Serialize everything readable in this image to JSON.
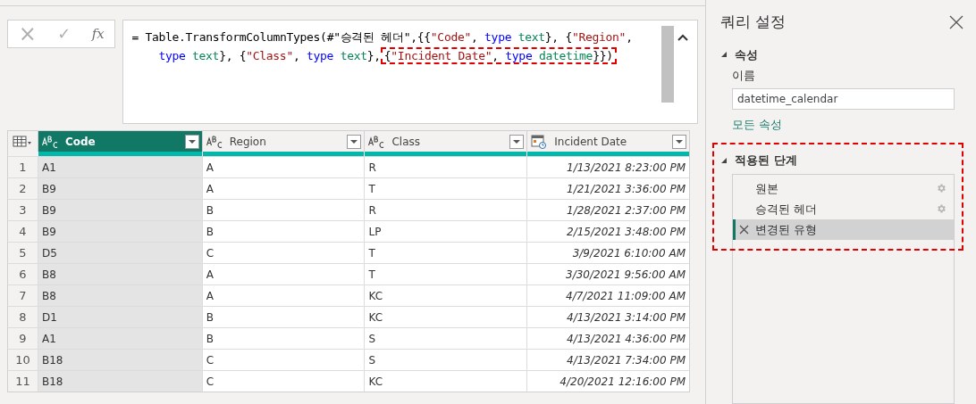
{
  "formula_bar": {
    "cancel": "×",
    "confirm": "✓",
    "fx": "fx",
    "lines": [
      {
        "tokens": [
          {
            "kind": "plain",
            "text": "= Table.TransformColumnTypes(#\"승격된 헤더\",{{"
          },
          {
            "kind": "string",
            "text": "\"Code\""
          },
          {
            "kind": "plain",
            "text": ", "
          },
          {
            "kind": "keyword",
            "text": "type "
          },
          {
            "kind": "type",
            "text": "text"
          },
          {
            "kind": "plain",
            "text": "}, {"
          },
          {
            "kind": "string",
            "text": "\"Region\""
          },
          {
            "kind": "plain",
            "text": ","
          }
        ]
      },
      {
        "tokens": [
          {
            "kind": "keyword",
            "text": "type "
          },
          {
            "kind": "type",
            "text": "text"
          },
          {
            "kind": "plain",
            "text": "}, {"
          },
          {
            "kind": "string",
            "text": "\"Class\""
          },
          {
            "kind": "plain",
            "text": ", "
          },
          {
            "kind": "keyword",
            "text": "type "
          },
          {
            "kind": "type",
            "text": "text"
          },
          {
            "kind": "plain",
            "text": "},"
          }
        ],
        "highlight": [
          {
            "kind": "plain",
            "text": "{"
          },
          {
            "kind": "string",
            "text": "\"Incident Date\""
          },
          {
            "kind": "plain",
            "text": ", "
          },
          {
            "kind": "keyword",
            "text": "type "
          },
          {
            "kind": "type",
            "text": "datetime"
          },
          {
            "kind": "plain",
            "text": "}})"
          }
        ]
      }
    ]
  },
  "table": {
    "columns": [
      {
        "name": "Code",
        "kind": "text",
        "selected": true
      },
      {
        "name": "Region",
        "kind": "text",
        "selected": false
      },
      {
        "name": "Class",
        "kind": "text",
        "selected": false
      },
      {
        "name": "Incident Date",
        "kind": "datetime",
        "selected": false
      }
    ],
    "rows": [
      {
        "index": "1",
        "cells": [
          "A1",
          "A",
          "R",
          "1/13/2021 8:23:00 PM"
        ]
      },
      {
        "index": "2",
        "cells": [
          "B9",
          "A",
          "T",
          "1/21/2021 3:36:00 PM"
        ]
      },
      {
        "index": "3",
        "cells": [
          "B9",
          "B",
          "R",
          "1/28/2021 2:37:00 PM"
        ]
      },
      {
        "index": "4",
        "cells": [
          "B9",
          "B",
          "LP",
          "2/15/2021 3:48:00 PM"
        ]
      },
      {
        "index": "5",
        "cells": [
          "D5",
          "C",
          "T",
          "3/9/2021 6:10:00 AM"
        ]
      },
      {
        "index": "6",
        "cells": [
          "B8",
          "A",
          "T",
          "3/30/2021 9:56:00 AM"
        ]
      },
      {
        "index": "7",
        "cells": [
          "B8",
          "A",
          "KC",
          "4/7/2021 11:09:00 AM"
        ]
      },
      {
        "index": "8",
        "cells": [
          "D1",
          "B",
          "KC",
          "4/13/2021 3:14:00 PM"
        ]
      },
      {
        "index": "9",
        "cells": [
          "A1",
          "B",
          "S",
          "4/13/2021 4:36:00 PM"
        ]
      },
      {
        "index": "10",
        "cells": [
          "B18",
          "C",
          "S",
          "4/13/2021 7:34:00 PM"
        ]
      },
      {
        "index": "11",
        "cells": [
          "B18",
          "C",
          "KC",
          "4/20/2021 12:16:00 PM"
        ]
      }
    ]
  },
  "query_settings": {
    "title": "쿼리 설정",
    "properties": {
      "heading": "속성",
      "name_label": "이름",
      "name_value": "datetime_calendar",
      "all_properties_link": "모든 속성"
    },
    "applied_steps": {
      "heading": "적용된 단계",
      "steps": [
        {
          "label": "원본",
          "selected": false,
          "has_settings": true
        },
        {
          "label": "승격된 헤더",
          "selected": false,
          "has_settings": true
        },
        {
          "label": "변경된 유형",
          "selected": true,
          "has_settings": false
        }
      ]
    }
  }
}
